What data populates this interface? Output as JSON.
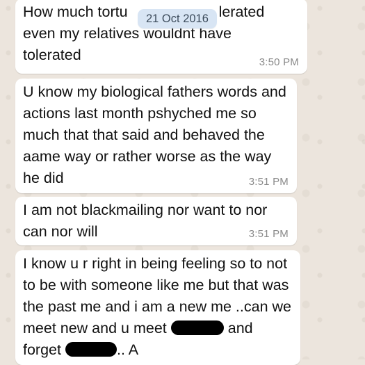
{
  "date_chip": "21 Oct 2016",
  "messages": [
    {
      "line1": "How much tortu",
      "line1_tail": "lerated",
      "line2": "even my relatives wouldnt have",
      "line3": "tolerated",
      "time": "3:50 PM"
    },
    {
      "text": "U know my biological fathers words and actions last month pshyched me so much that that said and behaved the aame way or rather worse as the way he did",
      "time": "3:51 PM"
    },
    {
      "text": "I am not blackmailing nor want to nor can nor will",
      "time": "3:51 PM"
    },
    {
      "text_start": "I know u r right in being feeling so to not to be with someone like me but that was the past me and i am a new me ..can we meet new and u meet",
      "text_mid": "and forget",
      "text_end": ".. A"
    }
  ],
  "colors": {
    "background": "#ECE5DD",
    "bubble": "#FFFFFF",
    "date_chip": "#D6E4F4",
    "timestamp": "#8A8A8A"
  }
}
